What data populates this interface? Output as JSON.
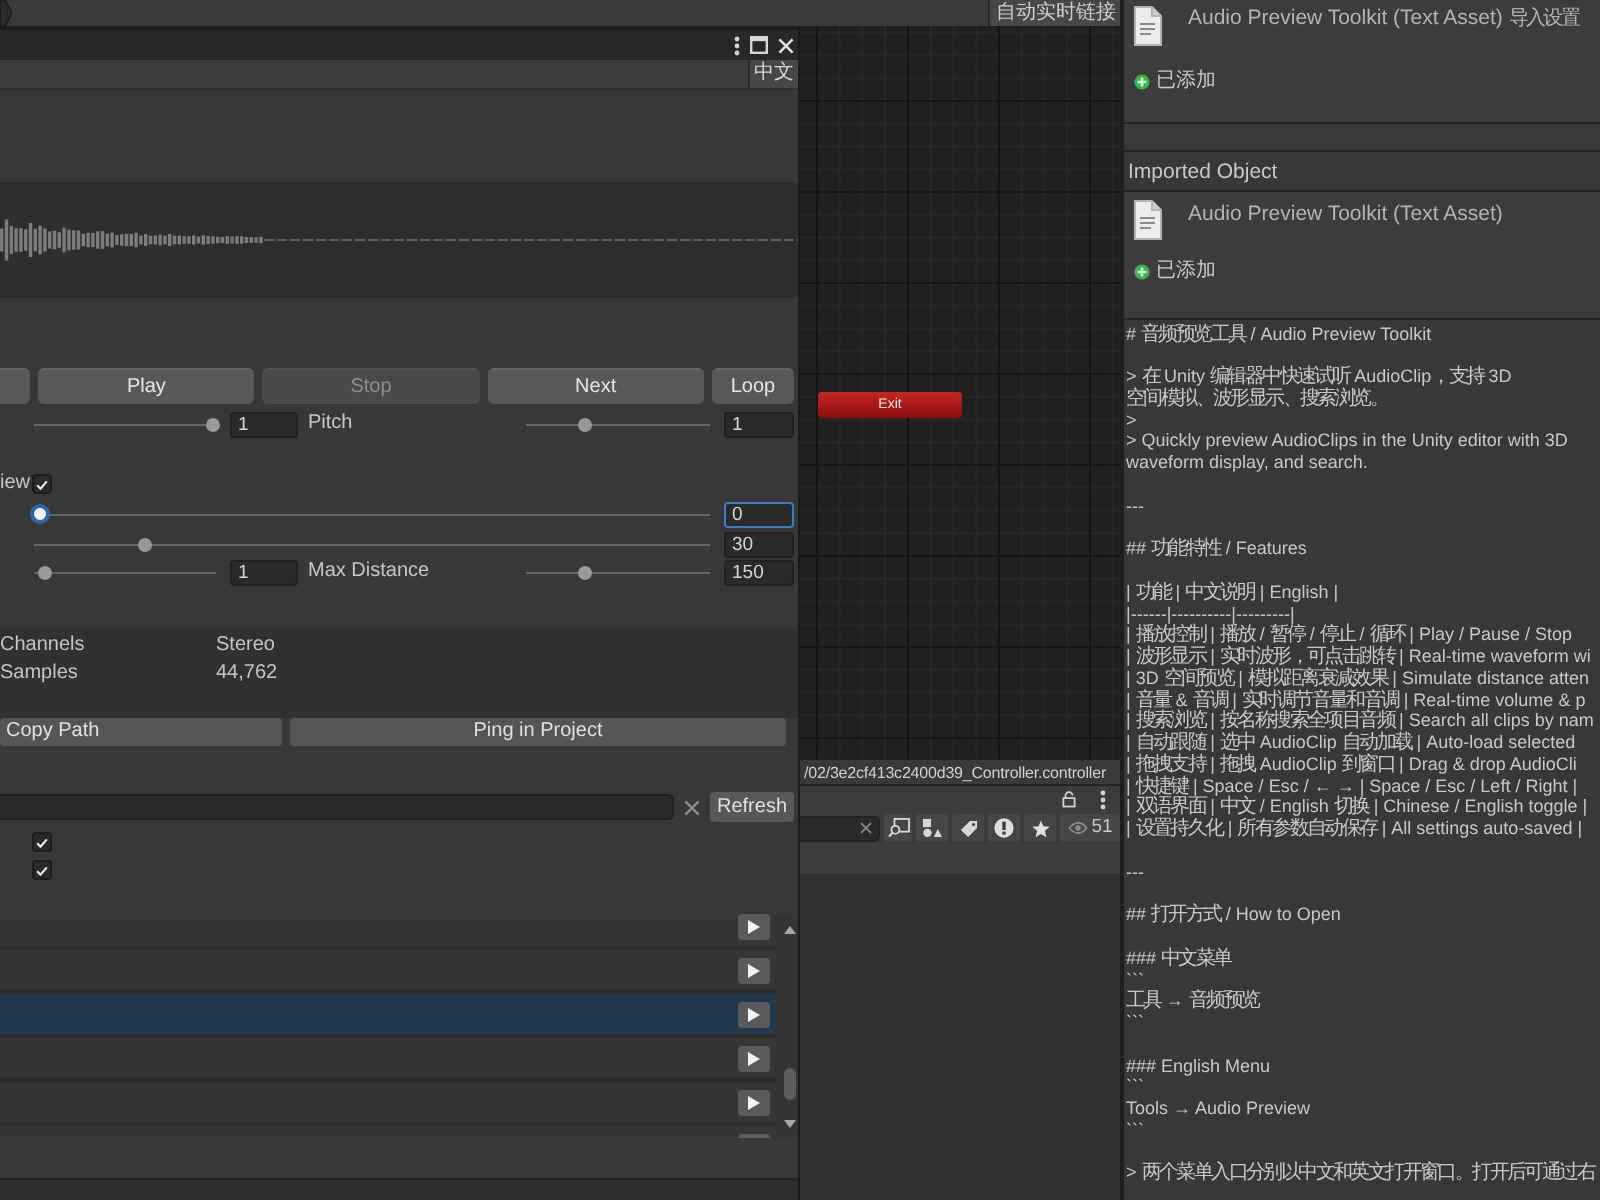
{
  "toolbar": {
    "live_link_button": "自动实时链接"
  },
  "preview_window": {
    "language_toggle": "中文",
    "transport": [
      {
        "kind": "stub",
        "disabled": false
      },
      {
        "kind": "labeled",
        "label": "Play",
        "disabled": false
      },
      {
        "kind": "labeled",
        "label": "Stop",
        "disabled": true
      },
      {
        "kind": "labeled",
        "label": "Next",
        "disabled": false
      },
      {
        "kind": "labeled",
        "label": "Loop",
        "disabled": false
      }
    ],
    "params": [
      {
        "kind": "pair",
        "left": {
          "level": 1,
          "value": "1"
        },
        "right": {
          "label": "Pitch",
          "level": 0.32,
          "value": "1"
        }
      },
      {
        "kind": "toggle",
        "label": "iew",
        "checked": true
      },
      {
        "kind": "wide",
        "level": 0,
        "value": "0",
        "focused": true
      },
      {
        "kind": "wide",
        "level": 0.16,
        "value": "30",
        "focused": false
      },
      {
        "kind": "pair",
        "left": {
          "level": 0.04,
          "value": "1"
        },
        "right": {
          "label": "Max Distance",
          "level": 0.31,
          "value": "150"
        }
      }
    ],
    "info": [
      {
        "label": "Channels",
        "value": "Stereo"
      },
      {
        "label": "Samples",
        "value": "44,762"
      }
    ],
    "actions": [
      "Copy Path",
      "Ping in Project"
    ],
    "refresh_button": "Refresh",
    "filters": [
      {
        "checked": true
      },
      {
        "checked": true
      }
    ],
    "clips": [
      {
        "selected": false
      },
      {
        "selected": false
      },
      {
        "selected": true
      },
      {
        "selected": false
      },
      {
        "selected": false
      },
      {
        "selected": false
      }
    ]
  },
  "animator": {
    "exit_node": "Exit",
    "path": "/02/3e2cf413c2400d39_Controller.controller"
  },
  "project_toolbar": {
    "count": "51"
  },
  "inspector": {
    "title": "Audio Preview Toolkit (Text Asset) 导入设置",
    "status": "已添加",
    "imported_object": {
      "header": "Imported Object",
      "title": "Audio Preview Toolkit (Text Asset)",
      "status": "已添加"
    },
    "text_blocks": [
      [
        "# 音频预览工具 / Audio Preview Toolkit"
      ],
      [
        "> 在 Unity 编辑器中快速试听 AudioClip，支持 3D",
        "空间模拟、波形显示、搜索浏览。",
        ">",
        "> Quickly preview AudioClips in the Unity editor with 3D",
        "waveform display, and search."
      ],
      [
        "---"
      ],
      [
        "## 功能特性 / Features"
      ],
      [
        "| 功能 | 中文说明 | English |",
        "|------|----------|---------|",
        "| 播放控制 | 播放 / 暂停 / 停止 / 循环 | Play / Pause / Stop",
        "| 波形显示 | 实时波形，可点击跳转 | Real-time waveform wi",
        "| 3D 空间预览 | 模拟距离衰减效果 | Simulate distance atten",
        "| 音量 & 音调 | 实时调节音量和音调 | Real-time volume & p",
        "| 搜索浏览 | 按名称搜索全项目音频 | Search all clips by nam",
        "| 自动跟随 | 选中 AudioClip 自动加载 | Auto-load selected",
        "| 拖拽支持 | 拖拽 AudioClip 到窗口 | Drag & drop AudioCli",
        "| 快捷键 | Space / Esc / ← → | Space / Esc / Left / Right |",
        "| 双语界面 | 中文 / English 切换 | Chinese / English toggle |",
        "| 设置持久化 | 所有参数自动保存 | All settings auto-saved |"
      ],
      [
        "---"
      ],
      [
        "## 打开方式 / How to Open"
      ],
      [
        "### 中文菜单",
        "```",
        "工具 → 音频预览",
        "```"
      ],
      [
        "### English Menu",
        "```",
        "Tools → Audio Preview",
        "```"
      ],
      [
        "> 两个菜单入口分别以中文和英文打开窗口。打开后可通过右"
      ]
    ]
  }
}
